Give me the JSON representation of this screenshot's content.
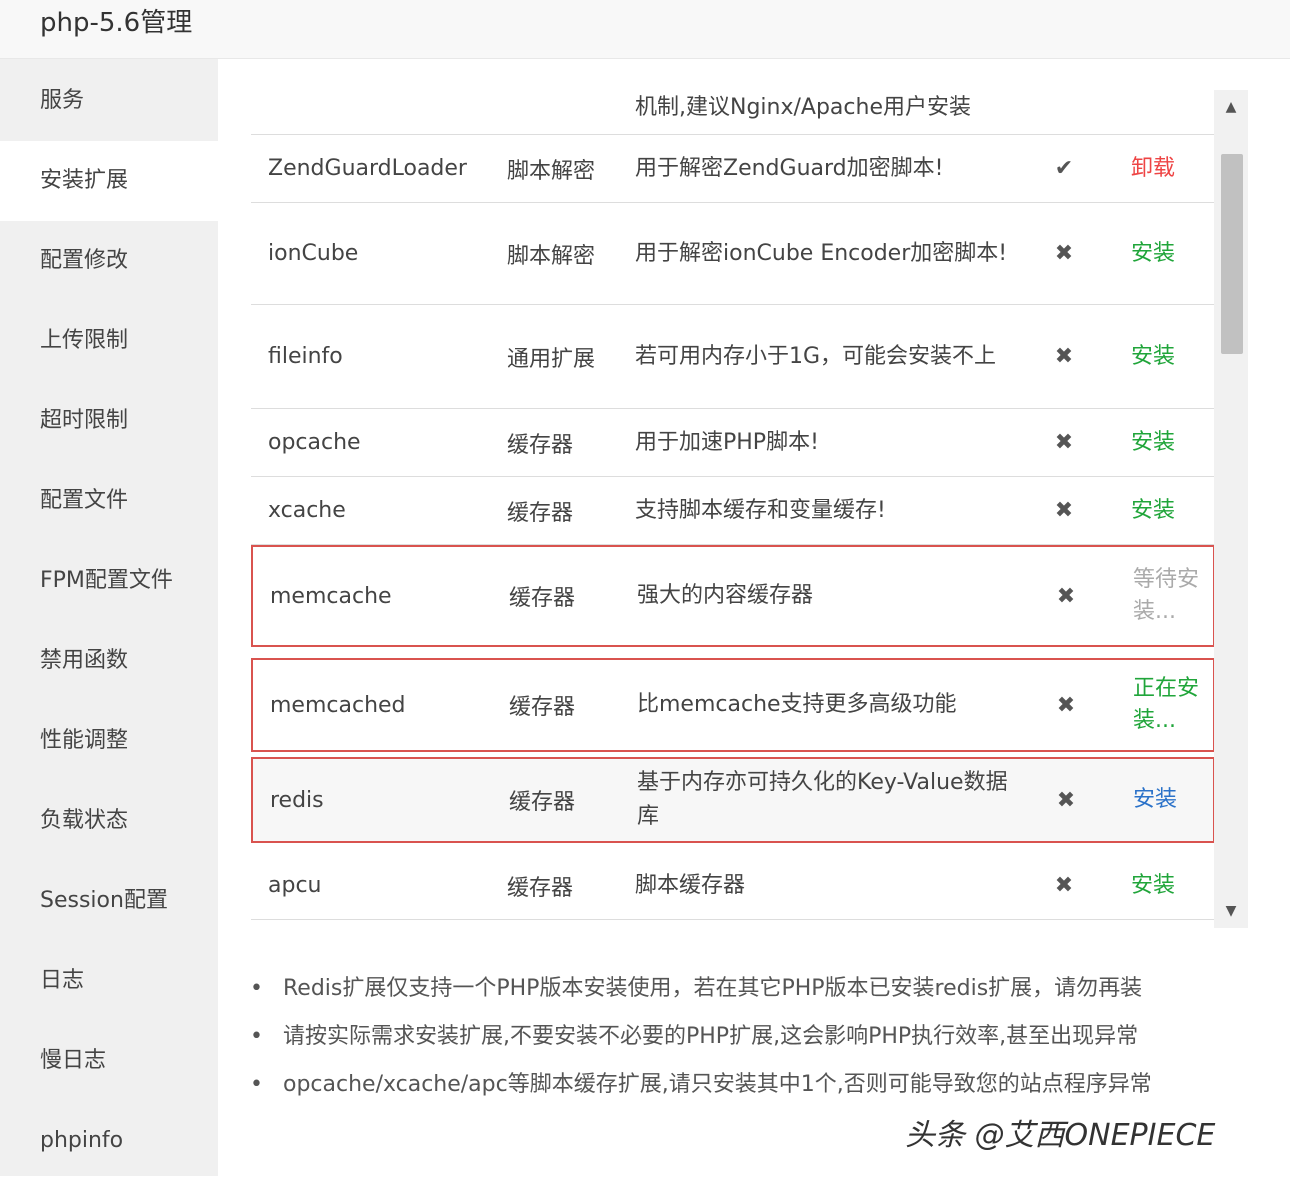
{
  "header": {
    "title": "php-5.6管理"
  },
  "sidebar": {
    "items": [
      {
        "label": "服务"
      },
      {
        "label": "安装扩展"
      },
      {
        "label": "配置修改"
      },
      {
        "label": "上传限制"
      },
      {
        "label": "超时限制"
      },
      {
        "label": "配置文件"
      },
      {
        "label": "FPM配置文件"
      },
      {
        "label": "禁用函数"
      },
      {
        "label": "性能调整"
      },
      {
        "label": "负载状态"
      },
      {
        "label": "Session配置"
      },
      {
        "label": "日志"
      },
      {
        "label": "慢日志"
      },
      {
        "label": "phpinfo"
      }
    ],
    "active": "安装扩展"
  },
  "extensions": {
    "partial_row": {
      "desc": "机制,建议Nginx/Apache用户安装"
    },
    "rows": [
      {
        "name": "ZendGuardLoader",
        "type": "脚本解密",
        "desc": "用于解密ZendGuard加密脚本!",
        "status_icon": "check-icon",
        "status": "✔",
        "op": "卸载"
      },
      {
        "name": "ionCube",
        "type": "脚本解密",
        "desc": "用于解密ionCube Encoder加密脚本!",
        "status_icon": "cross-icon",
        "status": "✖",
        "op": "安装"
      },
      {
        "name": "fileinfo",
        "type": "通用扩展",
        "desc": "若可用内存小于1G，可能会安装不上",
        "status_icon": "cross-icon",
        "status": "✖",
        "op": "安装"
      },
      {
        "name": "opcache",
        "type": "缓存器",
        "desc": "用于加速PHP脚本!",
        "status_icon": "cross-icon",
        "status": "✖",
        "op": "安装"
      },
      {
        "name": "xcache",
        "type": "缓存器",
        "desc": "支持脚本缓存和变量缓存!",
        "status_icon": "cross-icon",
        "status": "✖",
        "op": "安装"
      },
      {
        "name": "memcache",
        "type": "缓存器",
        "desc": "强大的内容缓存器",
        "status_icon": "cross-icon",
        "status": "✖",
        "op": "等待安装..."
      },
      {
        "name": "memcached",
        "type": "缓存器",
        "desc": "比memcache支持更多高级功能",
        "status_icon": "cross-icon",
        "status": "✖",
        "op": "正在安装..."
      },
      {
        "name": "redis",
        "type": "缓存器",
        "desc": "基于内存亦可持久化的Key-Value数据库",
        "status_icon": "cross-icon",
        "status": "✖",
        "op": "安装"
      },
      {
        "name": "apcu",
        "type": "缓存器",
        "desc": "脚本缓存器",
        "status_icon": "cross-icon",
        "status": "✖",
        "op": "安装"
      }
    ]
  },
  "scrollbar": {
    "up_icon": "▲",
    "down_icon": "▼"
  },
  "notes": [
    "Redis扩展仅支持一个PHP版本安装使用，若在其它PHP版本已安装redis扩展，请勿再装",
    "请按实际需求安装扩展,不要安装不必要的PHP扩展,这会影响PHP执行效率,甚至出现异常",
    "opcache/xcache/apc等脚本缓存扩展,请只安装其中1个,否则可能导致您的站点程序异常"
  ],
  "note_bullet": "•",
  "watermark": "头条 @艾西ONEPIECE",
  "colors": {
    "install": "#20a53a",
    "uninstall": "#ee4444",
    "highlight_border": "#d9534f",
    "install_blue": "#2b72c9"
  }
}
